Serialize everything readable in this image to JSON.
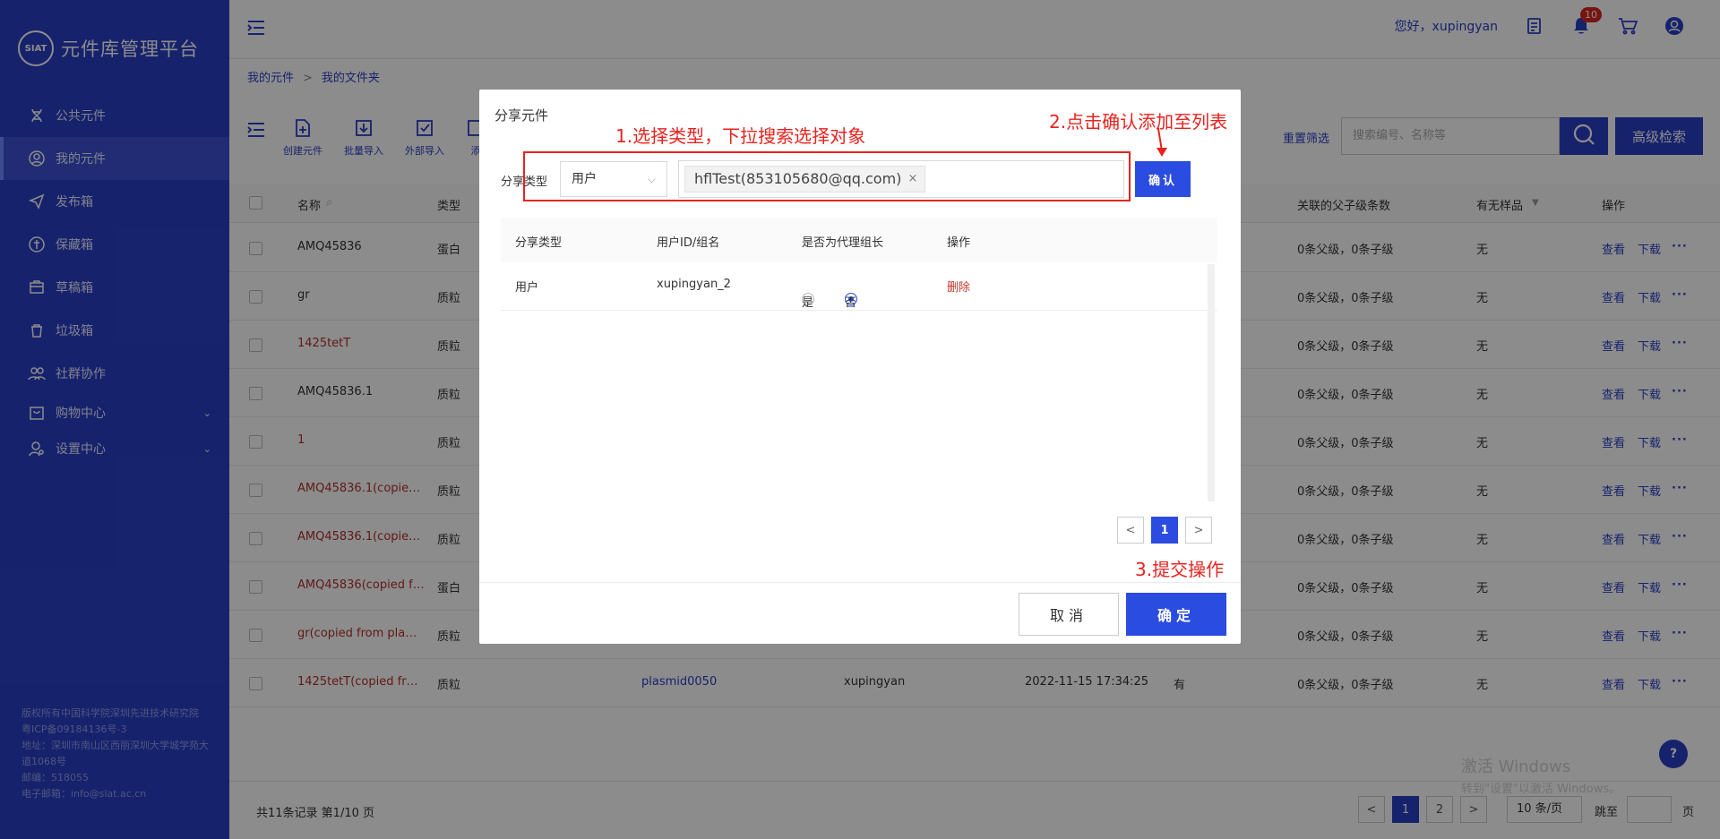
{
  "app": {
    "title": "元件库管理平台",
    "logo_text": "SIAT"
  },
  "sidebar": {
    "items": [
      {
        "label": "公共元件",
        "icon": "dna-icon"
      },
      {
        "label": "我的元件",
        "icon": "user-circle-icon"
      },
      {
        "label": "发布箱",
        "icon": "send-icon"
      },
      {
        "label": "保藏箱",
        "icon": "archive-icon"
      },
      {
        "label": "草稿箱",
        "icon": "draft-icon"
      },
      {
        "label": "垃圾箱",
        "icon": "trash-icon"
      },
      {
        "label": "社群协作",
        "icon": "group-icon"
      },
      {
        "label": "购物中心",
        "icon": "shop-icon",
        "chevron": "⌄"
      },
      {
        "label": "设置中心",
        "icon": "settings-user-icon",
        "chevron": "⌄"
      }
    ],
    "copyright": [
      "版权所有中国科学院深圳先进技术研究院 粤ICP备09184136号-3",
      "地址：深圳市南山区西丽深圳大学城学苑大道1068号",
      "邮编：518055",
      "电子邮箱：info@siat.ac.cn"
    ]
  },
  "header": {
    "greeting": "您好，xupingyan",
    "notification_count": "10"
  },
  "breadcrumb": {
    "root": "我的元件",
    "sep": ">",
    "current": "我的文件夹"
  },
  "toolbar": {
    "tools": [
      "创建元件",
      "批量导入",
      "外部导入",
      "添"
    ],
    "reset": "重置筛选",
    "search_placeholder": "搜索编号、名称等",
    "advanced": "高级检索"
  },
  "table": {
    "headers": {
      "name": "名称",
      "type": "类型",
      "relations": "关联的父子级条数",
      "sample": "有无样品",
      "ops": "操作"
    },
    "rows": [
      {
        "name": "AMQ45836",
        "type": "蛋白",
        "red": false,
        "relations": "0条父级，0条子级",
        "sample": "无"
      },
      {
        "name": "gr",
        "type": "质粒",
        "red": false,
        "relations": "0条父级，0条子级",
        "sample": "无"
      },
      {
        "name": "1425tetT",
        "type": "质粒",
        "red": true,
        "relations": "0条父级，0条子级",
        "sample": "无"
      },
      {
        "name": "AMQ45836.1",
        "type": "质粒",
        "red": false,
        "relations": "0条父级，0条子级",
        "sample": "无"
      },
      {
        "name": "1",
        "type": "质粒",
        "red": true,
        "relations": "0条父级，0条子级",
        "sample": "无"
      },
      {
        "name": "AMQ45836.1(copie…",
        "type": "质粒",
        "red": true,
        "relations": "0条父级，0条子级",
        "sample": "无"
      },
      {
        "name": "AMQ45836.1(copie…",
        "type": "质粒",
        "red": true,
        "relations": "0条父级，0条子级",
        "sample": "无"
      },
      {
        "name": "AMQ45836(copied f…",
        "type": "蛋白",
        "red": true,
        "relations": "0条父级，0条子级",
        "sample": "无"
      },
      {
        "name": "gr(copied from pla…",
        "type": "质粒",
        "red": true,
        "relations": "0条父级，0条子级",
        "sample": "无"
      },
      {
        "name": "1425tetT(copied fr…",
        "type": "质粒",
        "red": true,
        "relations": "0条父级，0条子级",
        "sample": "无",
        "code": "plasmid0050",
        "owner": "xupingyan",
        "time": "2022-11-15 17:34:25",
        "has": "有"
      }
    ],
    "view": "查看",
    "download": "下载",
    "more": "···"
  },
  "pagination": {
    "summary": "共11条记录 第1/10 页",
    "prev": "<",
    "next": ">",
    "pages": [
      "1",
      "2"
    ],
    "per_page": "10 条/页",
    "jump": "跳至",
    "page_unit": "页"
  },
  "watermark": {
    "line1": "激活 Windows",
    "line2": "转到\"设置\"以激活 Windows。"
  },
  "help": "?",
  "modal": {
    "title": "分享元件",
    "annotations": {
      "step1": "1.选择类型，下拉搜索选择对象",
      "step2": "2.点击确认添加至列表",
      "step3": "3.提交操作"
    },
    "type_label": "分享类型",
    "type_value": "用户",
    "tag": "hflTest(853105680@qq.com)",
    "tag_close": "×",
    "confirm": "确认",
    "columns": [
      "分享类型",
      "用户ID/组名",
      "是否为代理组长",
      "操作"
    ],
    "rows": [
      {
        "type": "用户",
        "id": "xupingyan_2",
        "yes": "是",
        "no": "否",
        "op": "删除"
      }
    ],
    "page": "1",
    "prev": "<",
    "next": ">",
    "cancel": "取消",
    "ok": "确定"
  },
  "colors": {
    "primary": "#2b3fc6",
    "accent": "#2b4ce0",
    "annotation": "#e8231f",
    "danger": "#b3302a"
  }
}
